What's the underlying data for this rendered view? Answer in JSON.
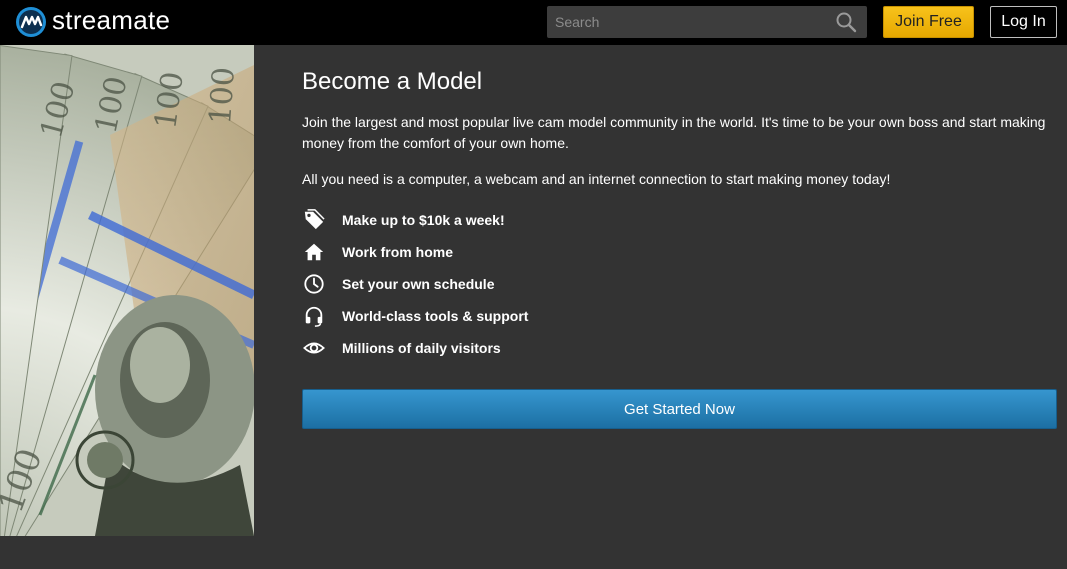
{
  "header": {
    "logo_text": "streamate",
    "search_placeholder": "Search",
    "join_label": "Join Free",
    "login_label": "Log In"
  },
  "main": {
    "title": "Become a Model",
    "intro": "Join the largest and most popular live cam model community in the world. It's time to be your own boss and start making money from the comfort of your own home.",
    "requirements": "All you need is a computer, a webcam and an internet connection to start making money today!",
    "features": [
      {
        "icon": "price-tag-icon",
        "label": "Make up to $10k a week!"
      },
      {
        "icon": "home-icon",
        "label": "Work from home"
      },
      {
        "icon": "clock-icon",
        "label": "Set your own schedule"
      },
      {
        "icon": "headset-icon",
        "label": "World-class tools & support"
      },
      {
        "icon": "eye-icon",
        "label": "Millions of daily visitors"
      }
    ],
    "cta_label": "Get Started Now"
  },
  "colors": {
    "header_bg": "#000000",
    "page_bg": "#333333",
    "join_yellow": "#f2b80c",
    "cta_blue": "#2a86c0"
  }
}
